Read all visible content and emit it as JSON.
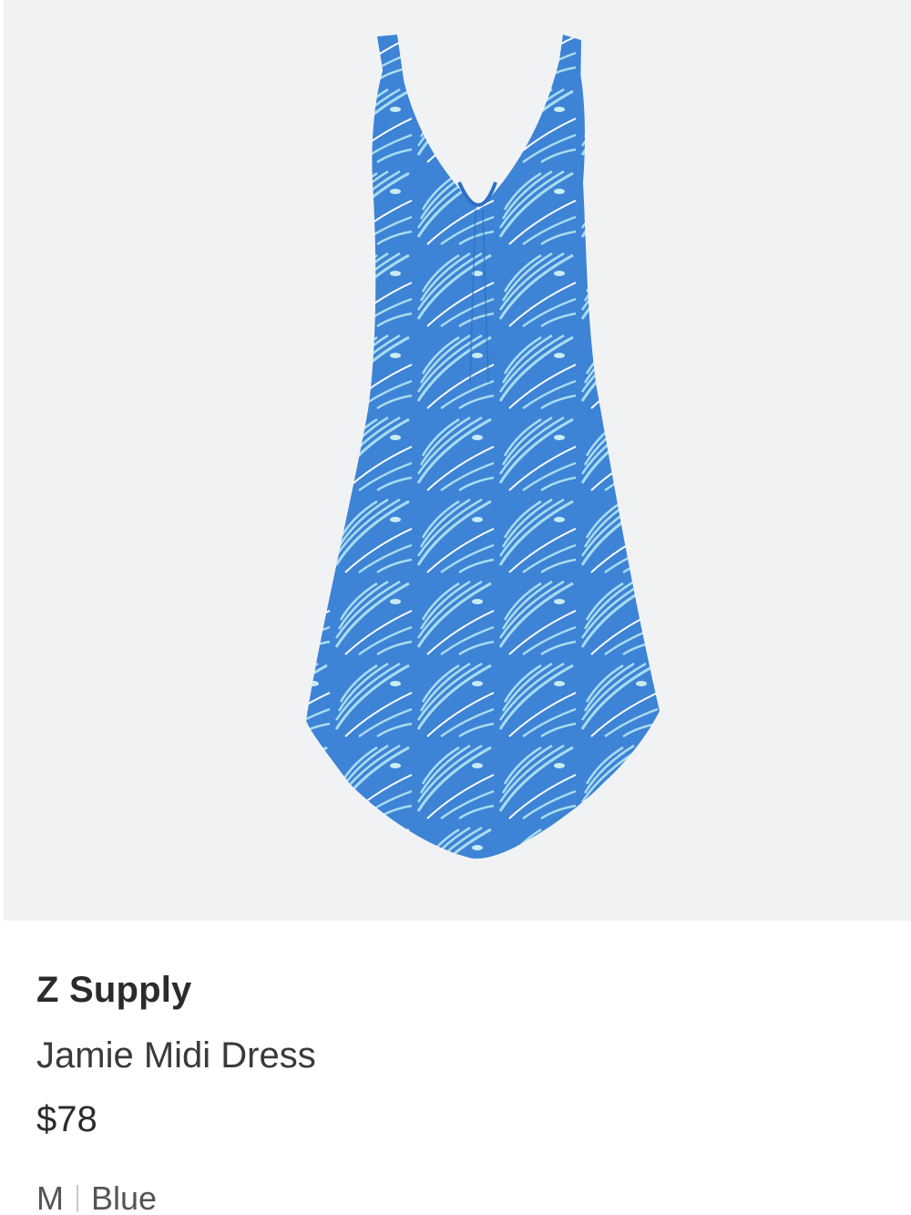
{
  "product": {
    "image_icon": "dress-photo",
    "brand": "Z Supply",
    "name": "Jamie Midi Dress",
    "price": "$78",
    "size": "M",
    "color": "Blue"
  },
  "colors": {
    "panel_background": "#f1f2f4",
    "dress_blue": "#3d83d6",
    "dress_light": "#a9dcef",
    "text_dark": "#2b2b2b"
  }
}
